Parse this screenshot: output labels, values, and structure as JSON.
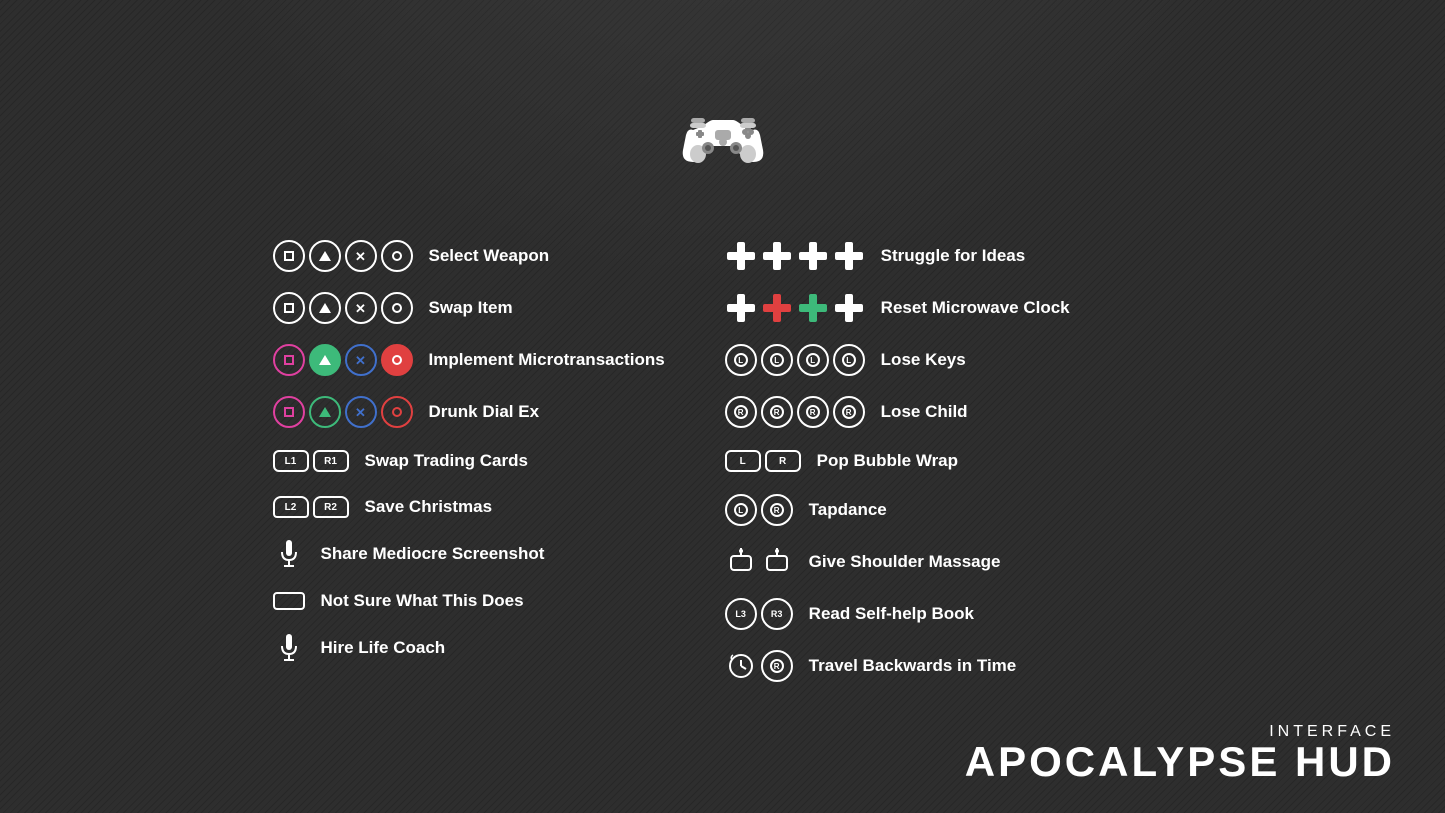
{
  "branding": {
    "top": "INTERFACE",
    "bottom": "APOCALYPSE HUD"
  },
  "controller_icon": "gamepad",
  "left_column": [
    {
      "id": "select-weapon",
      "label": "Select Weapon",
      "icons": [
        "square",
        "triangle",
        "cross",
        "circle"
      ],
      "colored": false
    },
    {
      "id": "swap-item",
      "label": "Swap Item",
      "icons": [
        "square",
        "triangle",
        "cross",
        "circle"
      ],
      "colored": false
    },
    {
      "id": "implement-microtransactions",
      "label": "Implement Microtransactions",
      "icons": [
        "square",
        "triangle",
        "cross",
        "circle"
      ],
      "colored": true
    },
    {
      "id": "drunk-dial-ex",
      "label": "Drunk Dial Ex",
      "icons": [
        "square",
        "triangle",
        "cross",
        "circle"
      ],
      "colored": "partial"
    },
    {
      "id": "swap-trading-cards",
      "label": "Swap Trading Cards",
      "icons": [
        "L1",
        "R1"
      ],
      "type": "shoulder"
    },
    {
      "id": "save-christmas",
      "label": "Save Christmas",
      "icons": [
        "L2",
        "R2"
      ],
      "type": "trigger"
    },
    {
      "id": "share-mediocre-screenshot",
      "label": "Share Mediocre Screenshot",
      "icons": [
        "mic"
      ],
      "type": "special"
    },
    {
      "id": "not-sure-what-this-does",
      "label": "Not Sure What This Does",
      "icons": [
        "touchpad"
      ],
      "type": "special"
    },
    {
      "id": "hire-life-coach",
      "label": "Hire Life Coach",
      "icons": [
        "mic2"
      ],
      "type": "special"
    }
  ],
  "right_column": [
    {
      "id": "struggle-for-ideas",
      "label": "Struggle for Ideas",
      "icons": [
        "dpad",
        "dpad",
        "dpad",
        "dpad"
      ],
      "type": "dpad"
    },
    {
      "id": "reset-microwave-clock",
      "label": "Reset Microwave Clock",
      "icons": [
        "dpad",
        "dpad",
        "dpad",
        "dpad"
      ],
      "type": "dpad-red"
    },
    {
      "id": "lose-keys",
      "label": "Lose Keys",
      "icons": [
        "L",
        "L",
        "L",
        "L"
      ],
      "type": "analog-l"
    },
    {
      "id": "lose-child",
      "label": "Lose Child",
      "icons": [
        "R",
        "R",
        "R",
        "R"
      ],
      "type": "analog-r"
    },
    {
      "id": "pop-bubble-wrap",
      "label": "Pop Bubble Wrap",
      "icons": [
        "L",
        "R"
      ],
      "type": "lr"
    },
    {
      "id": "tapdance",
      "label": "Tapdance",
      "icons": [
        "L",
        "R"
      ],
      "type": "lr2"
    },
    {
      "id": "give-shoulder-massage",
      "label": "Give Shoulder Massage",
      "icons": [
        "T",
        "T"
      ],
      "type": "touchpad2"
    },
    {
      "id": "read-self-help-book",
      "label": "Read Self-help Book",
      "icons": [
        "L3",
        "R3"
      ],
      "type": "l3r3"
    },
    {
      "id": "travel-backwards-in-time",
      "label": "Travel Backwards in Time",
      "icons": [
        "clock",
        "R"
      ],
      "type": "clockr"
    }
  ]
}
